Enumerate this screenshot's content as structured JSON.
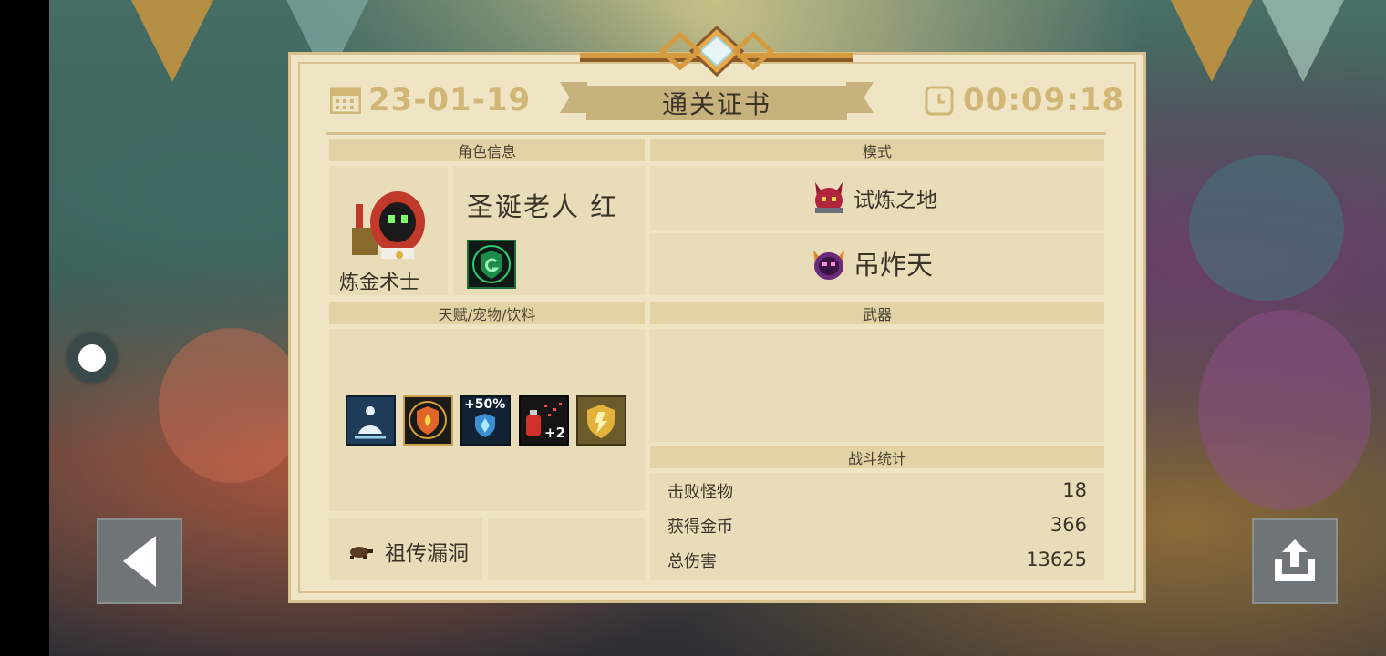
{
  "certificate": {
    "title": "通关证书",
    "date": "23-01-19",
    "time": "00:09:18"
  },
  "character": {
    "section_label": "角色信息",
    "name": "圣诞老人 红",
    "class": "炼金术士"
  },
  "mode": {
    "section_label": "模式",
    "items": [
      {
        "label": "试炼之地",
        "icon": "horned-demon-icon"
      },
      {
        "label": "吊炸天",
        "icon": "purple-demon-icon"
      }
    ]
  },
  "talents": {
    "section_label": "天赋/宠物/饮料",
    "items": [
      {
        "icon": "meditation-icon"
      },
      {
        "icon": "fire-shield-icon"
      },
      {
        "icon": "shield-boost-icon",
        "badge": "+50%"
      },
      {
        "icon": "potion-icon",
        "badge": "+2"
      },
      {
        "icon": "gold-shield-icon"
      }
    ],
    "pet": {
      "icon": "turtle-icon",
      "name": "祖传漏洞"
    }
  },
  "weapons": {
    "section_label": "武器"
  },
  "battle_stats": {
    "section_label": "战斗统计",
    "rows": [
      {
        "label": "击败怪物",
        "value": "18"
      },
      {
        "label": "获得金币",
        "value": "366"
      },
      {
        "label": "总伤害",
        "value": "13625"
      }
    ]
  },
  "colors": {
    "panel": "#efe4c3",
    "accent": "#d1b675",
    "text": "#3a3428"
  }
}
